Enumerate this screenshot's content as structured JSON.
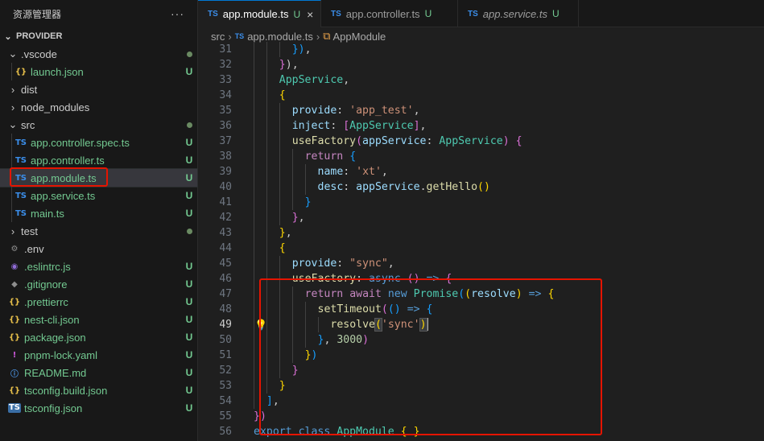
{
  "explorer": {
    "title": "资源管理器",
    "more_icon": "more-horizontal-icon",
    "root": "PROVIDER",
    "items": [
      {
        "name": ".vscode",
        "kind": "folder",
        "open": true,
        "depth": 0,
        "status": "dot"
      },
      {
        "name": "launch.json",
        "kind": "json",
        "depth": 1,
        "status": "U"
      },
      {
        "name": "dist",
        "kind": "folder",
        "open": false,
        "depth": 0,
        "status": ""
      },
      {
        "name": "node_modules",
        "kind": "folder",
        "open": false,
        "depth": 0,
        "status": ""
      },
      {
        "name": "src",
        "kind": "folder",
        "open": true,
        "depth": 0,
        "status": "dot"
      },
      {
        "name": "app.controller.spec.ts",
        "kind": "ts",
        "depth": 1,
        "status": "U"
      },
      {
        "name": "app.controller.ts",
        "kind": "ts",
        "depth": 1,
        "status": "U"
      },
      {
        "name": "app.module.ts",
        "kind": "ts",
        "depth": 1,
        "status": "U",
        "selected": true
      },
      {
        "name": "app.service.ts",
        "kind": "ts",
        "depth": 1,
        "status": "U"
      },
      {
        "name": "main.ts",
        "kind": "ts",
        "depth": 1,
        "status": "U"
      },
      {
        "name": "test",
        "kind": "folder",
        "open": false,
        "depth": 0,
        "status": "dot"
      },
      {
        "name": ".env",
        "kind": "env",
        "depth": 0,
        "status": ""
      },
      {
        "name": ".eslintrc.js",
        "kind": "eslint",
        "depth": 0,
        "status": "U"
      },
      {
        "name": ".gitignore",
        "kind": "git",
        "depth": 0,
        "status": "U"
      },
      {
        "name": ".prettierrc",
        "kind": "json",
        "depth": 0,
        "status": "U"
      },
      {
        "name": "nest-cli.json",
        "kind": "json",
        "depth": 0,
        "status": "U"
      },
      {
        "name": "package.json",
        "kind": "json",
        "depth": 0,
        "status": "U"
      },
      {
        "name": "pnpm-lock.yaml",
        "kind": "yaml",
        "depth": 0,
        "status": "U"
      },
      {
        "name": "README.md",
        "kind": "info",
        "depth": 0,
        "status": "U"
      },
      {
        "name": "tsconfig.build.json",
        "kind": "json",
        "depth": 0,
        "status": "U"
      },
      {
        "name": "tsconfig.json",
        "kind": "tsconfig",
        "depth": 0,
        "status": "U"
      }
    ]
  },
  "tabs": [
    {
      "label": "app.module.ts",
      "icon_text": "TS",
      "status": "U",
      "active": true,
      "close": "×"
    },
    {
      "label": "app.controller.ts",
      "icon_text": "TS",
      "status": "U",
      "active": false
    },
    {
      "label": "app.service.ts",
      "icon_text": "TS",
      "status": "U",
      "active": false,
      "preview": true
    }
  ],
  "breadcrumb": {
    "folder": "src",
    "file": "app.module.ts",
    "icon_text": "TS",
    "symbol": "AppModule"
  },
  "editor": {
    "current_line": 49,
    "lines": [
      {
        "n": 31,
        "ind": 3,
        "tok": [
          [
            "b3",
            "})"
          ],
          [
            "pl",
            ","
          ]
        ]
      },
      {
        "n": 32,
        "ind": 2,
        "tok": [
          [
            "b2",
            "}"
          ],
          [
            "pl",
            ")"
          ],
          [
            "pl",
            ","
          ]
        ]
      },
      {
        "n": 33,
        "ind": 2,
        "tok": [
          [
            "t",
            "AppService"
          ],
          [
            "pl",
            ","
          ]
        ]
      },
      {
        "n": 34,
        "ind": 2,
        "tok": [
          [
            "b1",
            "{"
          ]
        ]
      },
      {
        "n": 35,
        "ind": 3,
        "tok": [
          [
            "p",
            "provide"
          ],
          [
            "pl",
            ": "
          ],
          [
            "s",
            "'app_test'"
          ],
          [
            "pl",
            ","
          ]
        ]
      },
      {
        "n": 36,
        "ind": 3,
        "tok": [
          [
            "p",
            "inject"
          ],
          [
            "pl",
            ": "
          ],
          [
            "b2",
            "["
          ],
          [
            "t",
            "AppService"
          ],
          [
            "b2",
            "]"
          ],
          [
            "pl",
            ","
          ]
        ]
      },
      {
        "n": 37,
        "ind": 3,
        "tok": [
          [
            "f",
            "useFactory"
          ],
          [
            "b2",
            "("
          ],
          [
            "p",
            "appService"
          ],
          [
            "pl",
            ": "
          ],
          [
            "t",
            "AppService"
          ],
          [
            "b2",
            ")"
          ],
          [
            "pl",
            " "
          ],
          [
            "b2",
            "{"
          ]
        ]
      },
      {
        "n": 38,
        "ind": 4,
        "tok": [
          [
            "kc",
            "return"
          ],
          [
            "pl",
            " "
          ],
          [
            "b3",
            "{"
          ]
        ]
      },
      {
        "n": 39,
        "ind": 5,
        "tok": [
          [
            "p",
            "name"
          ],
          [
            "pl",
            ": "
          ],
          [
            "s",
            "'xt'"
          ],
          [
            "pl",
            ","
          ]
        ]
      },
      {
        "n": 40,
        "ind": 5,
        "tok": [
          [
            "p",
            "desc"
          ],
          [
            "pl",
            ": "
          ],
          [
            "p",
            "appService"
          ],
          [
            "pl",
            "."
          ],
          [
            "f",
            "getHello"
          ],
          [
            "b1",
            "()"
          ]
        ]
      },
      {
        "n": 41,
        "ind": 4,
        "tok": [
          [
            "b3",
            "}"
          ]
        ]
      },
      {
        "n": 42,
        "ind": 3,
        "tok": [
          [
            "b2",
            "}"
          ],
          [
            "pl",
            ","
          ]
        ]
      },
      {
        "n": 43,
        "ind": 2,
        "tok": [
          [
            "b1",
            "}"
          ],
          [
            "pl",
            ","
          ]
        ]
      },
      {
        "n": 44,
        "ind": 2,
        "tok": [
          [
            "b1",
            "{"
          ]
        ]
      },
      {
        "n": 45,
        "ind": 3,
        "tok": [
          [
            "p",
            "provide"
          ],
          [
            "pl",
            ": "
          ],
          [
            "s",
            "\"sync\""
          ],
          [
            "pl",
            ","
          ]
        ]
      },
      {
        "n": 46,
        "ind": 3,
        "tok": [
          [
            "f",
            "useFactory"
          ],
          [
            "pl",
            ": "
          ],
          [
            "k",
            "async"
          ],
          [
            "pl",
            " "
          ],
          [
            "b2",
            "()"
          ],
          [
            "pl",
            " "
          ],
          [
            "k",
            "=>"
          ],
          [
            "pl",
            " "
          ],
          [
            "b2",
            "{"
          ]
        ]
      },
      {
        "n": 47,
        "ind": 4,
        "tok": [
          [
            "kc",
            "return"
          ],
          [
            "pl",
            " "
          ],
          [
            "kc",
            "await"
          ],
          [
            "pl",
            " "
          ],
          [
            "k",
            "new"
          ],
          [
            "pl",
            " "
          ],
          [
            "t",
            "Promise"
          ],
          [
            "b3",
            "("
          ],
          [
            "b1",
            "("
          ],
          [
            "p",
            "resolve"
          ],
          [
            "b1",
            ")"
          ],
          [
            "pl",
            " "
          ],
          [
            "k",
            "=>"
          ],
          [
            "pl",
            " "
          ],
          [
            "b1",
            "{"
          ]
        ]
      },
      {
        "n": 48,
        "ind": 5,
        "tok": [
          [
            "f",
            "setTimeout"
          ],
          [
            "b2",
            "("
          ],
          [
            "b3",
            "()"
          ],
          [
            "pl",
            " "
          ],
          [
            "k",
            "=>"
          ],
          [
            "pl",
            " "
          ],
          [
            "b3",
            "{"
          ]
        ]
      },
      {
        "n": 49,
        "ind": 6,
        "tok": [
          [
            "f",
            "resolve"
          ],
          [
            "b1",
            "(",
            "sel"
          ],
          [
            "s",
            "'sync'"
          ],
          [
            "b1",
            ")",
            "sel"
          ],
          [
            "cur",
            ""
          ]
        ]
      },
      {
        "n": 50,
        "ind": 5,
        "tok": [
          [
            "b3",
            "}"
          ],
          [
            "pl",
            ", "
          ],
          [
            "n",
            "3000"
          ],
          [
            "b2",
            ")"
          ]
        ]
      },
      {
        "n": 51,
        "ind": 4,
        "tok": [
          [
            "b1",
            "}"
          ],
          [
            "b3",
            ")"
          ]
        ]
      },
      {
        "n": 52,
        "ind": 3,
        "tok": [
          [
            "b2",
            "}"
          ]
        ]
      },
      {
        "n": 53,
        "ind": 2,
        "tok": [
          [
            "b1",
            "}"
          ]
        ]
      },
      {
        "n": 54,
        "ind": 1,
        "tok": [
          [
            "b3",
            "]"
          ],
          [
            "pl",
            ","
          ]
        ]
      },
      {
        "n": 55,
        "ind": 0,
        "tok": [
          [
            "b2",
            "})"
          ]
        ]
      },
      {
        "n": 56,
        "ind": 0,
        "tok": [
          [
            "k",
            "export"
          ],
          [
            "pl",
            " "
          ],
          [
            "k",
            "class"
          ],
          [
            "pl",
            " "
          ],
          [
            "t",
            "AppModule"
          ],
          [
            "pl",
            " "
          ],
          [
            "b1",
            "{"
          ],
          [
            "pl",
            " "
          ],
          [
            "b1",
            "}"
          ]
        ]
      }
    ]
  },
  "colors": {
    "accent": "#0078d4",
    "highlight": "#e51400",
    "untracked": "#73c991"
  }
}
